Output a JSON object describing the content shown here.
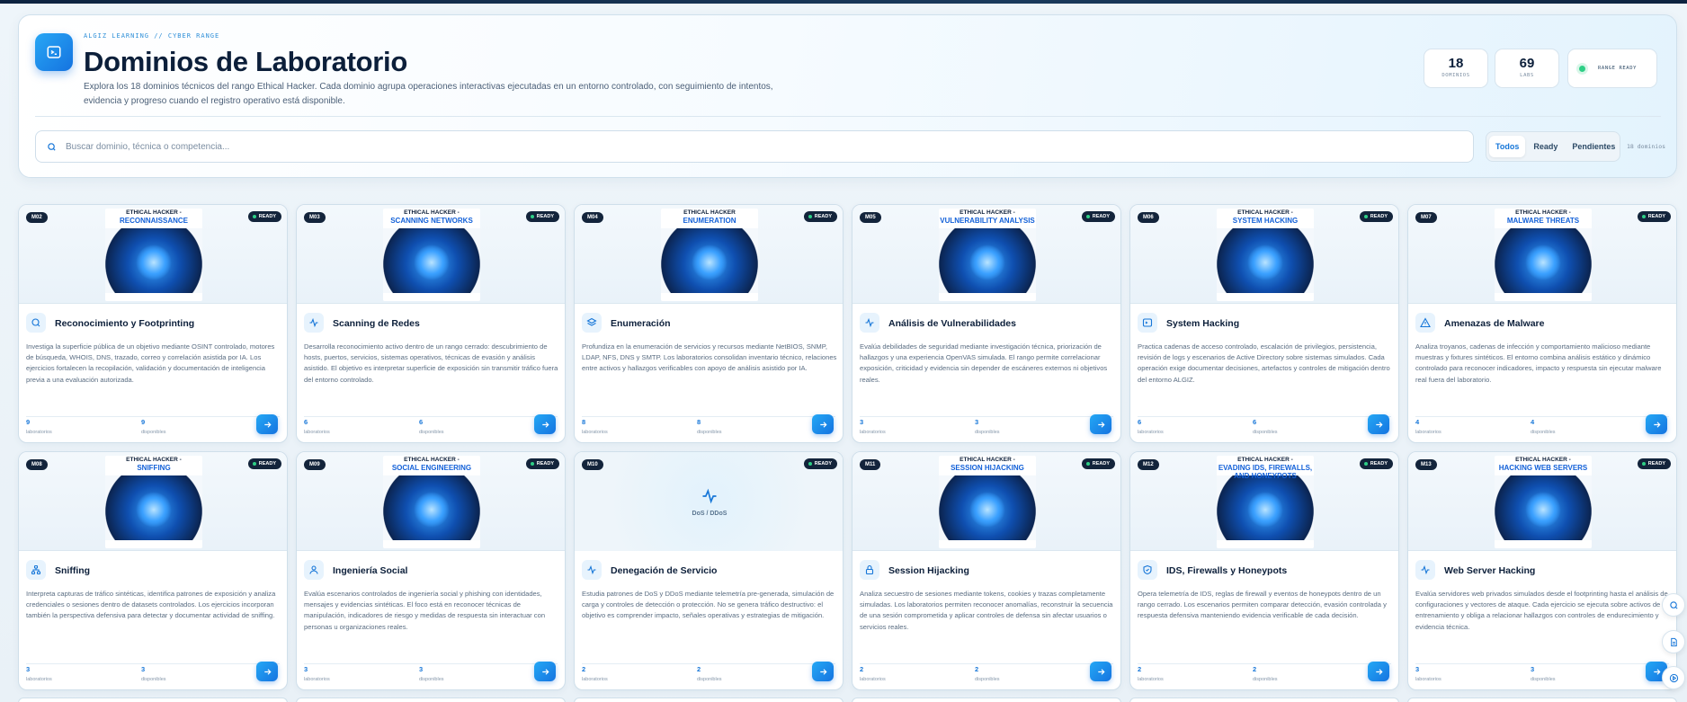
{
  "header": {
    "eyebrow": "ALGIZ LEARNING // CYBER RANGE",
    "title": "Dominios de Laboratorio",
    "subtitle": "Explora los 18 dominios técnicos del rango Ethical Hacker. Cada dominio agrupa operaciones interactivas ejecutadas en un entorno controlado, con seguimiento de intentos, evidencia y progreso cuando el registro operativo está disponible.",
    "stats": [
      {
        "value": "18",
        "label": "DOMINIOS"
      },
      {
        "value": "69",
        "label": "LABS"
      }
    ],
    "status": "RANGE READY"
  },
  "search": {
    "placeholder": "Buscar dominio, técnica o competencia..."
  },
  "filters": {
    "items": [
      "Todos",
      "Ready",
      "Pendientes"
    ],
    "active": "Todos",
    "count_text": "18 dominios"
  },
  "labels": {
    "labs": "laboratorios",
    "available": "disponibles",
    "ready": "READY"
  },
  "cards": [
    {
      "code": "M02",
      "icon": "search-icon",
      "thumb_a": "ETHICAL HACKER -",
      "thumb_b": "RECONNAISSANCE",
      "name": "Reconocimiento y Footprinting",
      "desc": "Investiga la superficie pública de un objetivo mediante OSINT controlado, motores de búsqueda, WHOIS, DNS, trazado, correo y correlación asistida por IA. Los ejercicios fortalecen la recopilación, validación y documentación de inteligencia previa a una evaluación autorizada.",
      "labs": "9",
      "available": "9"
    },
    {
      "code": "M03",
      "icon": "pulse-icon",
      "thumb_a": "ETHICAL HACKER -",
      "thumb_b": "SCANNING NETWORKS",
      "name": "Scanning de Redes",
      "desc": "Desarrolla reconocimiento activo dentro de un rango cerrado: descubrimiento de hosts, puertos, servicios, sistemas operativos, técnicas de evasión y análisis asistido. El objetivo es interpretar superficie de exposición sin transmitir tráfico fuera del entorno controlado.",
      "labs": "6",
      "available": "6"
    },
    {
      "code": "M04",
      "icon": "layers-icon",
      "thumb_a": "ETHICAL HACKER",
      "thumb_b": "ENUMERATION",
      "name": "Enumeración",
      "desc": "Profundiza en la enumeración de servicios y recursos mediante NetBIOS, SNMP, LDAP, NFS, DNS y SMTP. Los laboratorios consolidan inventario técnico, relaciones entre activos y hallazgos verificables con apoyo de análisis asistido por IA.",
      "labs": "8",
      "available": "8"
    },
    {
      "code": "M05",
      "icon": "pulse-icon",
      "thumb_a": "ETHICAL HACKER -",
      "thumb_b": "VULNERABILITY ANALYSIS",
      "name": "Análisis de Vulnerabilidades",
      "desc": "Evalúa debilidades de seguridad mediante investigación técnica, priorización de hallazgos y una experiencia OpenVAS simulada. El rango permite correlacionar exposición, criticidad y evidencia sin depender de escáneres externos ni objetivos reales.",
      "labs": "3",
      "available": "3"
    },
    {
      "code": "M06",
      "icon": "terminal-icon",
      "thumb_a": "ETHICAL HACKER -",
      "thumb_b": "SYSTEM HACKING",
      "name": "System Hacking",
      "desc": "Practica cadenas de acceso controlado, escalación de privilegios, persistencia, revisión de logs y escenarios de Active Directory sobre sistemas simulados. Cada operación exige documentar decisiones, artefactos y controles de mitigación dentro del entorno ALGIZ.",
      "labs": "6",
      "available": "6"
    },
    {
      "code": "M07",
      "icon": "warning-icon",
      "thumb_a": "ETHICAL HACKER -",
      "thumb_b": "MALWARE THREATS",
      "name": "Amenazas de Malware",
      "desc": "Analiza troyanos, cadenas de infección y comportamiento malicioso mediante muestras y fixtures sintéticos. El entorno combina análisis estático y dinámico controlado para reconocer indicadores, impacto y respuesta sin ejecutar malware real fuera del laboratorio.",
      "labs": "4",
      "available": "4"
    },
    {
      "code": "M08",
      "icon": "network-icon",
      "thumb_a": "ETHICAL HACKER -",
      "thumb_b": "SNIFFING",
      "name": "Sniffing",
      "desc": "Interpreta capturas de tráfico sintéticas, identifica patrones de exposición y analiza credenciales o sesiones dentro de datasets controlados. Los ejercicios incorporan también la perspectiva defensiva para detectar y documentar actividad de sniffing.",
      "labs": "3",
      "available": "3"
    },
    {
      "code": "M09",
      "icon": "user-icon",
      "thumb_a": "ETHICAL HACKER -",
      "thumb_b": "SOCIAL ENGINEERING",
      "name": "Ingeniería Social",
      "desc": "Evalúa escenarios controlados de ingeniería social y phishing con identidades, mensajes y evidencias sintéticas. El foco está en reconocer técnicas de manipulación, indicadores de riesgo y medidas de respuesta sin interactuar con personas u organizaciones reales.",
      "labs": "3",
      "available": "3"
    },
    {
      "code": "M10",
      "icon": "pulse-icon",
      "thumb_a": "",
      "thumb_b": "",
      "placeholder": "DoS / DDoS",
      "name": "Denegación de Servicio",
      "desc": "Estudia patrones de DoS y DDoS mediante telemetría pre-generada, simulación de carga y controles de detección o protección. No se genera tráfico destructivo: el objetivo es comprender impacto, señales operativas y estrategias de mitigación.",
      "labs": "2",
      "available": "2"
    },
    {
      "code": "M11",
      "icon": "lock-icon",
      "thumb_a": "ETHICAL HACKER -",
      "thumb_b": "SESSION HIJACKING",
      "name": "Session Hijacking",
      "desc": "Analiza secuestro de sesiones mediante tokens, cookies y trazas completamente simuladas. Los laboratorios permiten reconocer anomalías, reconstruir la secuencia de una sesión comprometida y aplicar controles de defensa sin afectar usuarios o servicios reales.",
      "labs": "2",
      "available": "2"
    },
    {
      "code": "M12",
      "icon": "shield-icon",
      "thumb_a": "ETHICAL HACKER -",
      "thumb_b": "EVADING IDS, FIREWALLS, AND HONEYPOTS",
      "name": "IDS, Firewalls y Honeypots",
      "desc": "Opera telemetría de IDS, reglas de firewall y eventos de honeypots dentro de un rango cerrado. Los escenarios permiten comparar detección, evasión controlada y respuesta defensiva manteniendo evidencia verificable de cada decisión.",
      "labs": "2",
      "available": "2"
    },
    {
      "code": "M13",
      "icon": "pulse-icon",
      "thumb_a": "ETHICAL HACKER -",
      "thumb_b": "HACKING WEB SERVERS",
      "name": "Web Server Hacking",
      "desc": "Evalúa servidores web privados simulados desde el footprinting hasta el análisis de configuraciones y vectores de ataque. Cada ejercicio se ejecuta sobre activos de entrenamiento y obliga a relacionar hallazgos con controles de endurecimiento y evidencia técnica.",
      "labs": "3",
      "available": "3"
    }
  ],
  "colors": {
    "accent": "#1676d8",
    "ready_green": "#2ecf86",
    "dark": "#13243b"
  }
}
